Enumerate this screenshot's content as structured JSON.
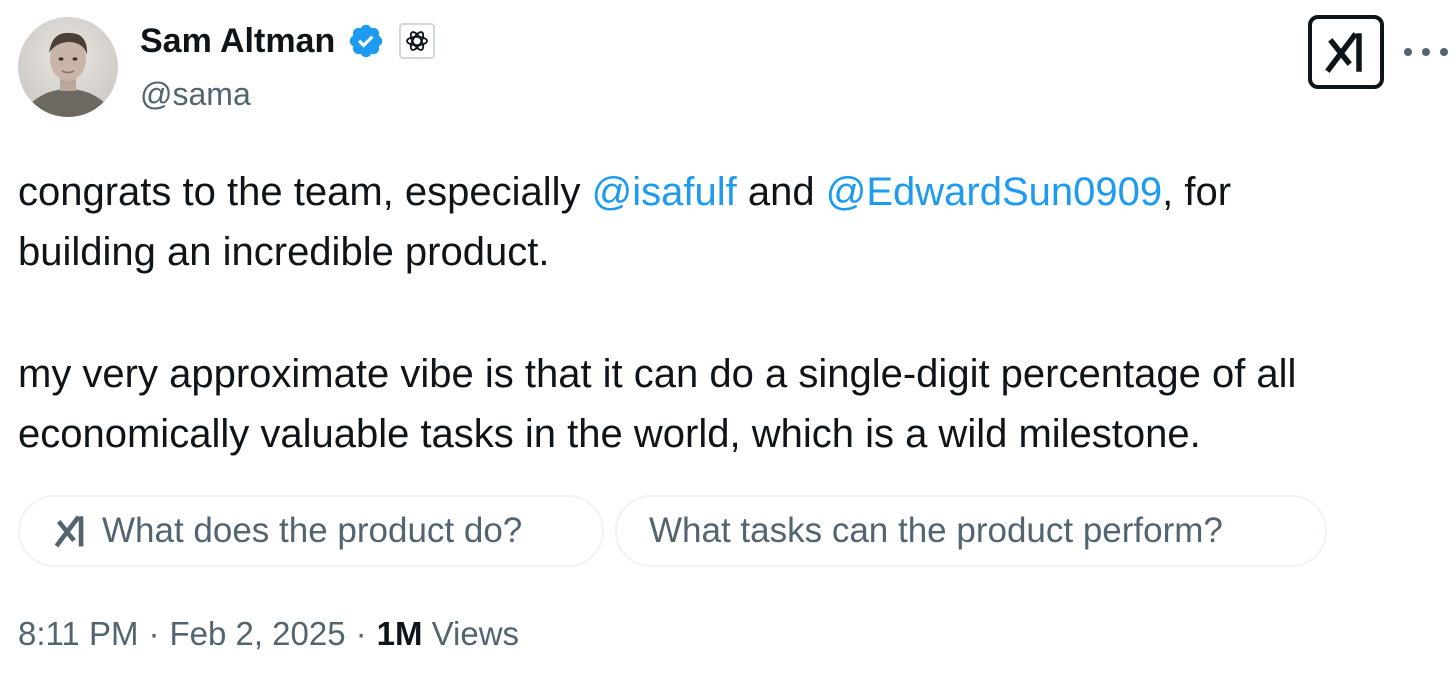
{
  "author": {
    "name": "Sam Altman",
    "handle": "@sama",
    "verified_icon": "verified-badge-icon",
    "affiliation_icon": "openai-logo-icon",
    "avatar": "avatar"
  },
  "header_actions": {
    "grok_icon": "grok-icon",
    "more_icon": "more-horizontal-icon"
  },
  "tweet": {
    "para1": {
      "before": "congrats to the team, especially ",
      "mention1": "@isafulf",
      "middle": " and ",
      "mention2": "@EdwardSun0909",
      "after": ", for"
    },
    "para1_line2": "building an incredible product.",
    "para2_line1": "my very approximate vibe is that it can do a single-digit percentage of all",
    "para2_line2": "economically valuable tasks in the world, which is a wild milestone."
  },
  "grok_suggestions": [
    {
      "label": "What does the product do?",
      "icon": "grok-icon"
    },
    {
      "label": "What tasks can the product perform?"
    }
  ],
  "meta": {
    "time": "8:11 PM",
    "separator": "·",
    "date": "Feb 2, 2025",
    "views_count": "1M",
    "views_label": "Views"
  },
  "colors": {
    "text": "#0f1419",
    "secondary": "#536471",
    "link": "#1d9bf0",
    "verified": "#1d9bf0",
    "border": "#eff3f4"
  }
}
